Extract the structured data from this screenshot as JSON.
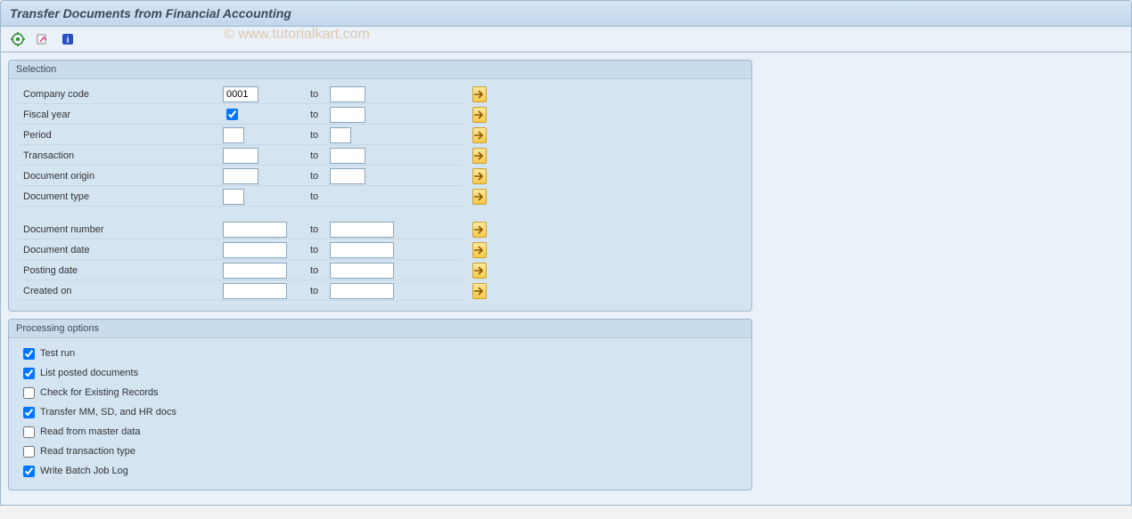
{
  "title": "Transfer Documents from Financial Accounting",
  "watermark": "© www.tutorialkart.com",
  "selection": {
    "title": "Selection",
    "to": "to",
    "rows1": [
      {
        "label": "Company code",
        "from": "0001",
        "to": "",
        "wfrom": "short",
        "wto": "short"
      },
      {
        "label": "Fiscal year",
        "check": true,
        "to": "",
        "wfrom": "check",
        "wto": "short"
      },
      {
        "label": "Period",
        "from": "",
        "to": "",
        "wfrom": "tiny",
        "wto": "tiny"
      },
      {
        "label": "Transaction",
        "from": "",
        "to": "",
        "wfrom": "short",
        "wto": "short"
      },
      {
        "label": "Document origin",
        "from": "",
        "to": "",
        "wfrom": "short",
        "wto": "short"
      },
      {
        "label": "Document type",
        "from": "",
        "to": "",
        "wfrom": "tiny",
        "wto": ""
      }
    ],
    "rows2": [
      {
        "label": "Document number",
        "from": "",
        "to": "",
        "wfrom": "med",
        "wto": "med"
      },
      {
        "label": "Document date",
        "from": "",
        "to": "",
        "wfrom": "med",
        "wto": "med"
      },
      {
        "label": "Posting date",
        "from": "",
        "to": "",
        "wfrom": "med",
        "wto": "med"
      },
      {
        "label": "Created on",
        "from": "",
        "to": "",
        "wfrom": "med",
        "wto": "med"
      }
    ]
  },
  "processing": {
    "title": "Processing options",
    "options": [
      {
        "label": "Test run",
        "checked": true
      },
      {
        "label": "List posted documents",
        "checked": true
      },
      {
        "label": "Check for Existing Records",
        "checked": false
      },
      {
        "label": "Transfer MM, SD, and HR docs",
        "checked": true
      },
      {
        "label": "Read from master data",
        "checked": false
      },
      {
        "label": "Read transaction type",
        "checked": false
      },
      {
        "label": "Write Batch Job Log",
        "checked": true
      }
    ]
  }
}
